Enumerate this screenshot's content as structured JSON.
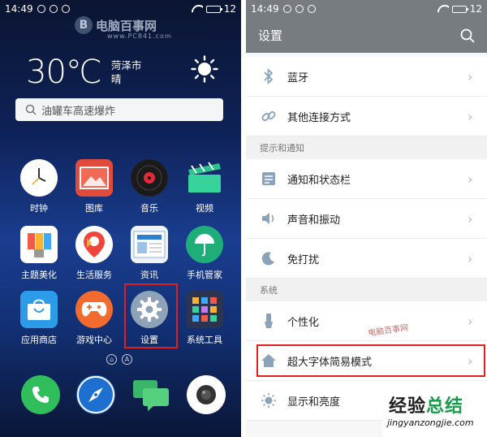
{
  "home": {
    "status": {
      "time": "14:49",
      "battery": "12"
    },
    "watermark": {
      "logo_letter": "B",
      "name": "电脑百事网",
      "sub": "www.PC841.com"
    },
    "weather": {
      "temp": "30℃",
      "city": "菏泽市",
      "condition": "晴"
    },
    "search": {
      "placeholder": "油罐车高速爆炸"
    },
    "apps": [
      {
        "label": "时钟",
        "icon": "clock-icon"
      },
      {
        "label": "图库",
        "icon": "gallery-icon"
      },
      {
        "label": "音乐",
        "icon": "music-icon"
      },
      {
        "label": "视频",
        "icon": "video-icon"
      },
      {
        "label": "主题美化",
        "icon": "theme-icon"
      },
      {
        "label": "生活服务",
        "icon": "life-service-icon"
      },
      {
        "label": "资讯",
        "icon": "news-icon"
      },
      {
        "label": "手机管家",
        "icon": "phone-manager-icon"
      },
      {
        "label": "应用商店",
        "icon": "app-store-icon"
      },
      {
        "label": "游戏中心",
        "icon": "game-center-icon"
      },
      {
        "label": "设置",
        "icon": "settings-gear-icon"
      },
      {
        "label": "系统工具",
        "icon": "system-tools-icon"
      }
    ],
    "page_indicator_label": "A",
    "dock": [
      "phone-icon",
      "browser-icon",
      "messages-icon",
      "camera-icon"
    ],
    "highlight_color": "#e02020"
  },
  "settings": {
    "status": {
      "time": "14:49",
      "battery": "12"
    },
    "title": "设置",
    "rows_top": [
      {
        "label": "蓝牙",
        "icon": "bluetooth-icon"
      },
      {
        "label": "其他连接方式",
        "icon": "link-icon"
      }
    ],
    "section1": "提示和通知",
    "rows_mid": [
      {
        "label": "通知和状态栏",
        "icon": "notification-icon"
      },
      {
        "label": "声音和振动",
        "icon": "sound-icon"
      },
      {
        "label": "免打扰",
        "icon": "moon-icon"
      }
    ],
    "section2": "系统",
    "rows_sys": [
      {
        "label": "个性化",
        "icon": "personalize-icon"
      },
      {
        "label": "超大字体简易模式",
        "icon": "home-icon"
      },
      {
        "label": "显示和亮度",
        "icon": "brightness-icon"
      }
    ],
    "mid_watermark": "电脑百事网",
    "corner_watermark": {
      "main": "经验",
      "accent": "总结",
      "url": "jingyanzongjie.com"
    },
    "header_color": "#777c80"
  }
}
